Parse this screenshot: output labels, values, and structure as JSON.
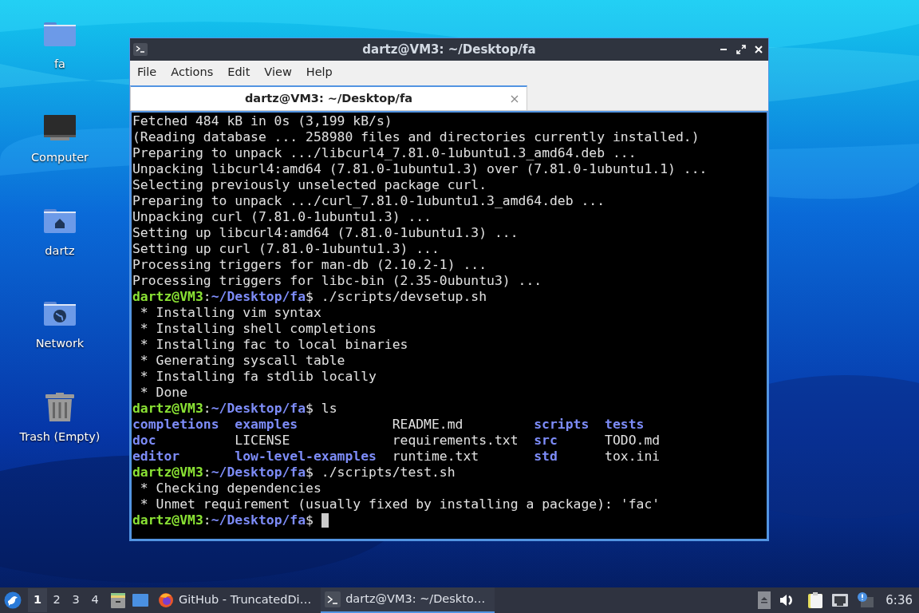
{
  "desktop_icons": [
    {
      "kind": "folder",
      "label": "fa"
    },
    {
      "kind": "computer",
      "label": "Computer"
    },
    {
      "kind": "home",
      "label": "dartz"
    },
    {
      "kind": "network",
      "label": "Network"
    },
    {
      "kind": "trash",
      "label": "Trash (Empty)"
    }
  ],
  "window": {
    "title": "dartz@VM3: ~/Desktop/fa",
    "menu": [
      "File",
      "Actions",
      "Edit",
      "View",
      "Help"
    ],
    "tabs": [
      {
        "label": "dartz@VM3: ~/Desktop/fa",
        "selected": true
      }
    ],
    "terminal": {
      "lines": [
        {
          "kind": "output",
          "text": "Fetched 484 kB in 0s (3,199 kB/s)"
        },
        {
          "kind": "output",
          "text": "(Reading database ... 258980 files and directories currently installed.)"
        },
        {
          "kind": "output",
          "text": "Preparing to unpack .../libcurl4_7.81.0-1ubuntu1.3_amd64.deb ..."
        },
        {
          "kind": "output",
          "text": "Unpacking libcurl4:amd64 (7.81.0-1ubuntu1.3) over (7.81.0-1ubuntu1.1) ..."
        },
        {
          "kind": "output",
          "text": "Selecting previously unselected package curl."
        },
        {
          "kind": "output",
          "text": "Preparing to unpack .../curl_7.81.0-1ubuntu1.3_amd64.deb ..."
        },
        {
          "kind": "output",
          "text": "Unpacking curl (7.81.0-1ubuntu1.3) ..."
        },
        {
          "kind": "output",
          "text": "Setting up libcurl4:amd64 (7.81.0-1ubuntu1.3) ..."
        },
        {
          "kind": "output",
          "text": "Setting up curl (7.81.0-1ubuntu1.3) ..."
        },
        {
          "kind": "output",
          "text": "Processing triggers for man-db (2.10.2-1) ..."
        },
        {
          "kind": "output",
          "text": "Processing triggers for libc-bin (2.35-0ubuntu3) ..."
        },
        {
          "kind": "prompt",
          "user": "dartz@VM3",
          "sep": ":",
          "path": "~/Desktop/fa",
          "command": "$ ./scripts/devsetup.sh"
        },
        {
          "kind": "output",
          "text": " * Installing vim syntax"
        },
        {
          "kind": "output",
          "text": " * Installing shell completions"
        },
        {
          "kind": "output",
          "text": " * Installing fac to local binaries"
        },
        {
          "kind": "output",
          "text": " * Generating syscall table"
        },
        {
          "kind": "output",
          "text": " * Installing fa stdlib locally"
        },
        {
          "kind": "output",
          "text": " * Done"
        },
        {
          "kind": "prompt",
          "user": "dartz@VM3",
          "sep": ":",
          "path": "~/Desktop/fa",
          "command": "$ ls"
        },
        {
          "kind": "ls",
          "cells": [
            {
              "text": "completions",
              "dir": true
            },
            {
              "text": "examples",
              "dir": true
            },
            {
              "text": "README.md",
              "dir": false
            },
            {
              "text": "scripts",
              "dir": true
            },
            {
              "text": "tests",
              "dir": true
            }
          ]
        },
        {
          "kind": "ls",
          "cells": [
            {
              "text": "doc",
              "dir": true
            },
            {
              "text": "LICENSE",
              "dir": false
            },
            {
              "text": "requirements.txt",
              "dir": false
            },
            {
              "text": "src",
              "dir": true
            },
            {
              "text": "TODO.md",
              "dir": false
            }
          ]
        },
        {
          "kind": "ls",
          "cells": [
            {
              "text": "editor",
              "dir": true
            },
            {
              "text": "low-level-examples",
              "dir": true
            },
            {
              "text": "runtime.txt",
              "dir": false
            },
            {
              "text": "std",
              "dir": true
            },
            {
              "text": "tox.ini",
              "dir": false
            }
          ]
        },
        {
          "kind": "prompt",
          "user": "dartz@VM3",
          "sep": ":",
          "path": "~/Desktop/fa",
          "command": "$ ./scripts/test.sh"
        },
        {
          "kind": "output",
          "text": " * Checking dependencies"
        },
        {
          "kind": "output",
          "text": " * Unmet requirement (usually fixed by installing a package): 'fac'"
        },
        {
          "kind": "prompt",
          "user": "dartz@VM3",
          "sep": ":",
          "path": "~/Desktop/fa",
          "command": "$",
          "cursor": true
        }
      ]
    }
  },
  "taskbar": {
    "workspaces": [
      {
        "label": "1",
        "selected": true
      },
      {
        "label": "2",
        "selected": false
      },
      {
        "label": "3",
        "selected": false
      },
      {
        "label": "4",
        "selected": false
      }
    ],
    "tasks": [
      {
        "kind": "browser",
        "label": "GitHub - TruncatedDi…",
        "selected": false
      },
      {
        "kind": "terminal",
        "label": "dartz@VM3: ~/Deskto…",
        "selected": true
      }
    ],
    "clock": "6:36"
  }
}
